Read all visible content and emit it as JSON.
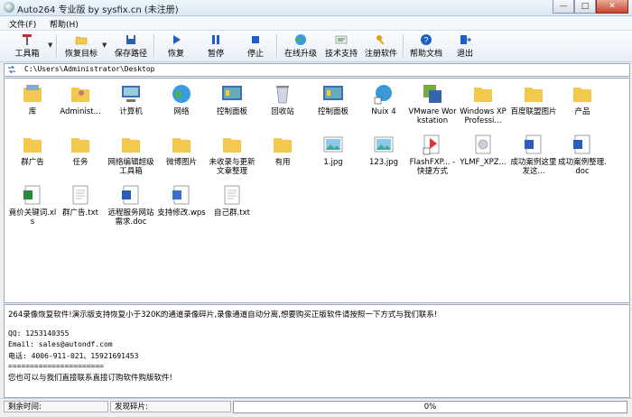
{
  "window": {
    "title": "Auto264 专业版 by sysfix.cn (未注册)",
    "min": "—",
    "max": "□",
    "close": "✕"
  },
  "menu": [
    {
      "label": "文件(F)"
    },
    {
      "label": "帮助(H)"
    }
  ],
  "toolbar": {
    "toolbox": "工具箱",
    "restore_target": "恢复目标",
    "save_path": "保存路径",
    "restore": "恢复",
    "pause": "暂停",
    "stop": "停止",
    "online_upgrade": "在线升级",
    "tech_support": "技术支持",
    "register": "注册软件",
    "help_docs": "帮助文档",
    "exit": "退出"
  },
  "address": {
    "path": "C:\\Users\\Administrator\\Desktop"
  },
  "files": [
    {
      "name": "库",
      "icon": "library-icon"
    },
    {
      "name": "Administ...",
      "icon": "user-folder-icon"
    },
    {
      "name": "计算机",
      "icon": "computer-icon"
    },
    {
      "name": "网络",
      "icon": "network-icon"
    },
    {
      "name": "控制面板",
      "icon": "control-panel-icon"
    },
    {
      "name": "回收站",
      "icon": "recycle-bin-icon"
    },
    {
      "name": "控制面板",
      "icon": "control-panel-icon"
    },
    {
      "name": "Nuix 4",
      "icon": "shortcut-app-icon"
    },
    {
      "name": "VMware Workstation",
      "icon": "vmware-icon"
    },
    {
      "name": "Windows XP Professi...",
      "icon": "folder-icon"
    },
    {
      "name": "百度联盟图片",
      "icon": "folder-icon"
    },
    {
      "name": "产品",
      "icon": "folder-icon"
    },
    {
      "name": "群广告",
      "icon": "folder-icon"
    },
    {
      "name": "任务",
      "icon": "folder-icon"
    },
    {
      "name": "网络编辑超级工具箱",
      "icon": "folder-icon"
    },
    {
      "name": "微博图片",
      "icon": "folder-icon"
    },
    {
      "name": "未收录与更新文章整理",
      "icon": "folder-icon"
    },
    {
      "name": "有用",
      "icon": "folder-icon"
    },
    {
      "name": "1.jpg",
      "icon": "image-file-icon"
    },
    {
      "name": "123.jpg",
      "icon": "image-file-icon"
    },
    {
      "name": "FlashFXP... - 快捷方式",
      "icon": "flashfxp-shortcut-icon"
    },
    {
      "name": "YLMF_XPZ...",
      "icon": "iso-file-icon"
    },
    {
      "name": "成功案例这里发这...",
      "icon": "word-doc-icon"
    },
    {
      "name": "成功案例整理.doc",
      "icon": "word-doc-icon"
    },
    {
      "name": "竟价关键词.xls",
      "icon": "excel-file-icon"
    },
    {
      "name": "群广告.txt",
      "icon": "text-file-icon"
    },
    {
      "name": "远程服务网站需求.doc",
      "icon": "word-doc-icon"
    },
    {
      "name": "支持修改.wps",
      "icon": "wps-file-icon"
    },
    {
      "name": "自己群.txt",
      "icon": "text-file-icon"
    }
  ],
  "messages": {
    "line1": "264录像恢复软件!演示版支持恢复小于320K的通道录像碎片,录像通道自动分离,想要购买正版软件请按照一下方式与我们联系!",
    "qq": "QQ: 1253140355",
    "email": "Email: sales@autondf.com",
    "phone": "电话: 4006-911-021、15921691453",
    "divider": "======================",
    "line_last": "您也可以与我们直接联系直接订购软件购版软件!"
  },
  "status": {
    "remaining_label": "剩余时间:",
    "fragments_label": "发现碎片:",
    "progress_text": "0%",
    "progress": 0
  },
  "colors": {
    "folder": "#f2c94c",
    "accent": "#1f5fbf",
    "progress": "#6fbf4a"
  }
}
